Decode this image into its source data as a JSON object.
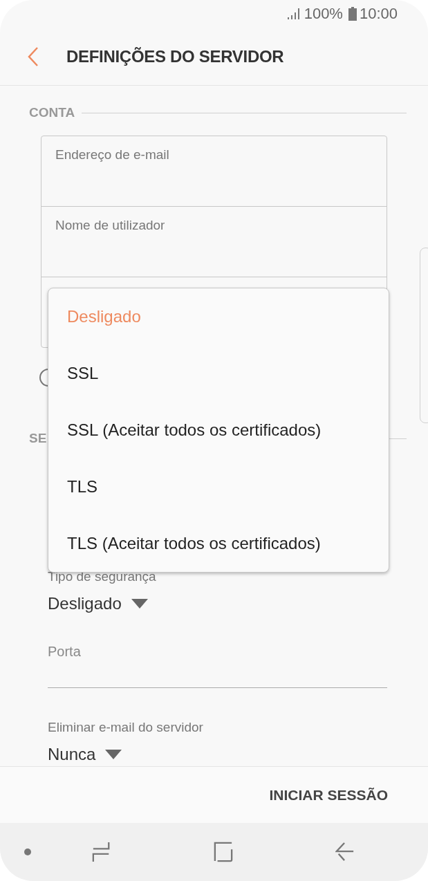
{
  "status_bar": {
    "battery": "100%",
    "time": "10:00"
  },
  "header": {
    "title": "DEFINIÇÕES DO SERVIDOR"
  },
  "account": {
    "heading": "CONTA",
    "fields": [
      {
        "placeholder": "Endereço de e-mail"
      },
      {
        "placeholder": "Nome de utilizador"
      }
    ],
    "show_password": {
      "checked": false
    }
  },
  "server": {
    "heading": "SE",
    "security": {
      "label": "Tipo de segurança",
      "value": "Desligado"
    },
    "port": {
      "placeholder": "Porta"
    },
    "delete": {
      "label": "Eliminar e-mail do servidor",
      "value": "Nunca"
    }
  },
  "menu": [
    {
      "label": "Desligado",
      "selected": true
    },
    {
      "label": "SSL",
      "selected": false
    },
    {
      "label": "SSL (Aceitar todos os certificados)",
      "selected": false
    },
    {
      "label": "TLS",
      "selected": false
    },
    {
      "label": "TLS (Aceitar todos os certificados)",
      "selected": false
    }
  ],
  "footer": {
    "button": "INICIAR SESSÃO"
  }
}
